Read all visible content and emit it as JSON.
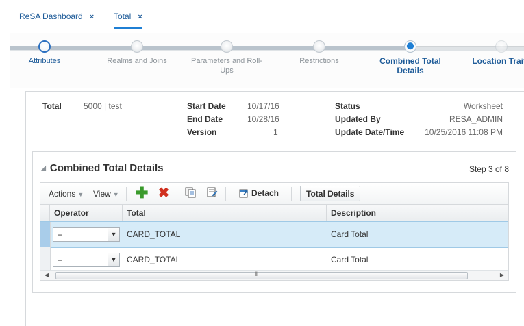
{
  "tabs": [
    {
      "label": "ReSA Dashboard",
      "close": "×"
    },
    {
      "label": "Total",
      "close": "×"
    }
  ],
  "train": {
    "stops": [
      {
        "label": "Attributes",
        "state": "visited"
      },
      {
        "label": "Realms and Joins",
        "state": "unvisited"
      },
      {
        "label": "Parameters and Roll-Ups",
        "state": "unvisited"
      },
      {
        "label": "Restrictions",
        "state": "unvisited"
      },
      {
        "label": "Combined Total Details",
        "state": "current"
      },
      {
        "label": "Location Traits",
        "state": "unvisited"
      }
    ]
  },
  "header": {
    "total_label": "Total",
    "total_value": "5000 | test",
    "start_date_label": "Start Date",
    "start_date_value": "10/17/16",
    "end_date_label": "End Date",
    "end_date_value": "10/28/16",
    "version_label": "Version",
    "version_value": "1",
    "status_label": "Status",
    "status_value": "Worksheet",
    "updated_by_label": "Updated By",
    "updated_by_value": "RESA_ADMIN",
    "update_datetime_label": "Update Date/Time",
    "update_datetime_value": "10/25/2016 11:08 PM"
  },
  "panel": {
    "title": "Combined Total Details",
    "step": "Step 3 of 8",
    "toolbar": {
      "actions_label": "Actions",
      "view_label": "View",
      "detach_label": "Detach",
      "total_details_label": "Total Details",
      "icons": [
        "add-icon",
        "delete-icon",
        "duplicate-icon",
        "edit-icon",
        "detach-icon"
      ]
    },
    "columns": [
      "Operator",
      "Total",
      "Description"
    ],
    "rows": [
      {
        "operator": "+",
        "total": "CARD_TOTAL",
        "description": "Card Total",
        "selected": true
      },
      {
        "operator": "+",
        "total": "CARD_TOTAL",
        "description": "Card Total",
        "selected": false
      }
    ],
    "scroll_grip": "III"
  },
  "colors": {
    "link": "#1f5c99",
    "accent": "#1f7fd4",
    "selected_row": "#d6ebf8",
    "add_green": "#3a9a2c",
    "delete_red": "#d0301f"
  }
}
